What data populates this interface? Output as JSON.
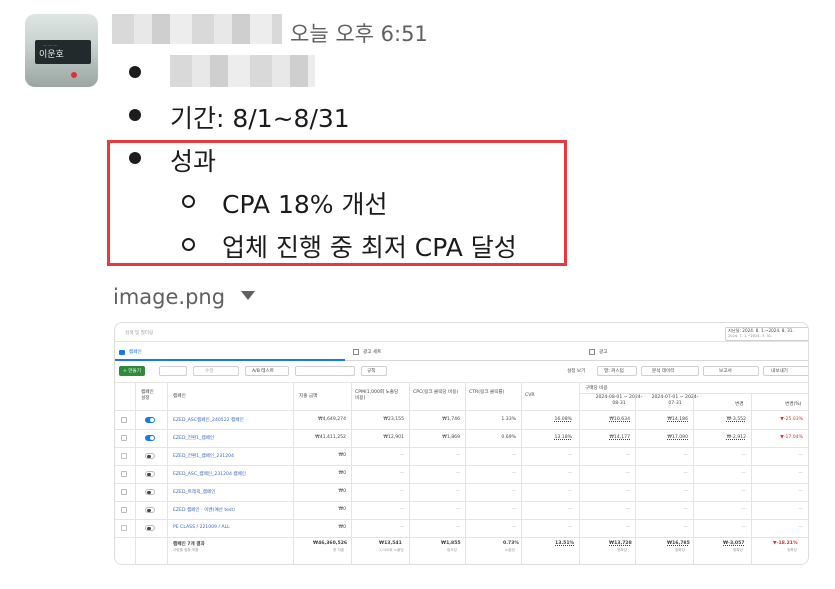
{
  "message": {
    "timestamp": "오늘 오후 6:51",
    "avatar_sign": "이운호",
    "bullets": [
      {
        "text": ""
      },
      {
        "text": "기간: 8/1~8/31"
      },
      {
        "text": "성과",
        "sub": [
          {
            "text": "CPA 18% 개선"
          },
          {
            "text": "업체 진행 중 최저 CPA 달성"
          }
        ]
      }
    ],
    "attachment": {
      "filename": "image.png"
    }
  },
  "screenshot": {
    "search_placeholder": "검색 및 필터링",
    "date_range": "지난달: 2024. 8. 1.~2024. 8. 31.",
    "date_range_compare": "2024. 7. 1.~2024. 7. 31.",
    "tabs": [
      "캠페인",
      "광고 세트",
      "광고"
    ],
    "toolbar": {
      "create": "+ 만들기",
      "edit": "수정",
      "ab_test": "A/B 테스트",
      "rules": "규칙",
      "setting": "설정 보기",
      "column": "열: 커스텀",
      "breakdown": "분석 데이터",
      "report": "보고서",
      "export": "내보내기"
    },
    "table": {
      "headers": {
        "toggle": "캠페인 설정",
        "name": "캠페인",
        "spend": "지출 금액",
        "cpm": "CPM(1,000회 노출당 비용)",
        "cpc": "CPC(링크 클릭당 비용)",
        "ctr": "CTR(링크 클릭률)",
        "cvr": "CVR",
        "cpp_group": "구매당 비용",
        "cpp_a": "2024-08-01 ~ 2024-08-31",
        "cpp_b": "2024-07-01 ~ 2024-07-31",
        "change": "변경",
        "change_pct": "변경(%)"
      },
      "rows": [
        {
          "on": true,
          "name": "EZED_ASC캠페인_240522 캠페인",
          "spend": "₩4,649,274",
          "cpm": "₩23,155",
          "cpc": "₩1,746",
          "ctr": "1.33%",
          "cvr": "16.08%",
          "cpp_a": "₩10,634",
          "cpp_b": "₩14,186",
          "change": "₩-3,552",
          "change_pct": "▼-25.03%"
        },
        {
          "on": true,
          "name": "EZED_전환1_캠페인",
          "spend": "₩41,411,252",
          "cpm": "₩12,901",
          "cpc": "₩1,869",
          "ctr": "0.69%",
          "cvr": "13.18%",
          "cpp_a": "₩14,177",
          "cpp_b": "₩17,090",
          "change": "₩-2,912",
          "change_pct": "▼-17.04%"
        },
        {
          "on": false,
          "name": "EZED_전환1_캠페인_231204",
          "spend": "₩0",
          "cpm": "—",
          "cpc": "—",
          "ctr": "—",
          "cvr": "—",
          "cpp_a": "—",
          "cpp_b": "—",
          "change": "—",
          "change_pct": "—"
        },
        {
          "on": false,
          "name": "EZED_ASC_캠페인_231204 캠페인",
          "spend": "₩0",
          "cpm": "—",
          "cpc": "—",
          "ctr": "—",
          "cvr": "—",
          "cpp_a": "—",
          "cpp_b": "—",
          "change": "—",
          "change_pct": "—"
        },
        {
          "on": false,
          "name": "EZED_트래픽_캠페인",
          "spend": "₩0",
          "cpm": "—",
          "cpc": "—",
          "ctr": "—",
          "cvr": "—",
          "cpp_a": "—",
          "cpp_b": "—",
          "change": "—",
          "change_pct": "—"
        },
        {
          "on": false,
          "name": "EZED 캠페인 - 이벤(예산 test)",
          "spend": "₩0",
          "cpm": "—",
          "cpc": "—",
          "ctr": "—",
          "cvr": "—",
          "cpp_a": "—",
          "cpp_b": "—",
          "change": "—",
          "change_pct": "—"
        },
        {
          "on": false,
          "name": "PE CLASS / 221009 / ALL",
          "spend": "₩0",
          "cpm": "—",
          "cpc": "—",
          "ctr": "—",
          "cvr": "—",
          "cpp_a": "—",
          "cpp_b": "—",
          "change": "—",
          "change_pct": "—"
        }
      ],
      "total": {
        "name": "캠페인 7개 결과",
        "sub": "사람을 정확 적용",
        "spend": "₩46,360,526",
        "spend_sub": "총 지출",
        "cpm": "₩13,541",
        "cpm_sub": "1,000회 노출당",
        "cpc": "₩1,855",
        "cpc_sub": "링크당",
        "ctr": "0.73%",
        "ctr_sub": "노출당",
        "cvr": "13.51%",
        "cpp_a": "₩13,728",
        "cpp_b": "₩16,785",
        "change": "₩-3,057",
        "change_pct": "▼-18.21%",
        "unit": "정확당"
      }
    }
  }
}
